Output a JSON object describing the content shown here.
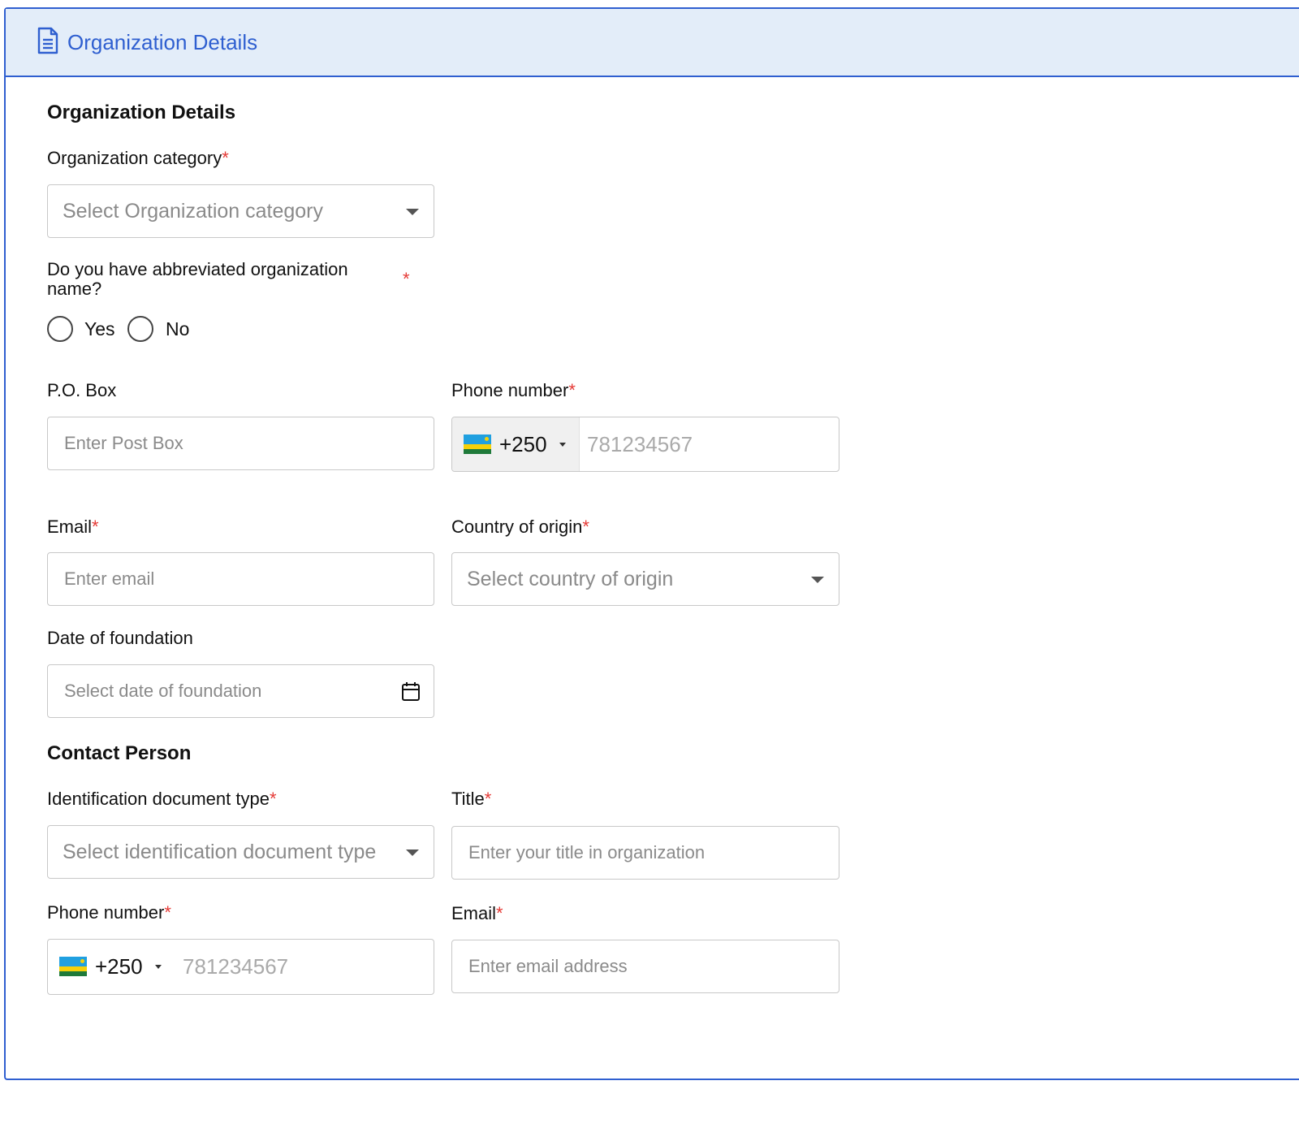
{
  "header": {
    "title": "Organization Details",
    "icon": "document-icon"
  },
  "org_section": {
    "title": "Organization Details"
  },
  "org_category": {
    "label": "Organization category",
    "required": "*",
    "placeholder": "Select Organization category"
  },
  "abbreviated": {
    "label_line1": "Do you have abbreviated organization",
    "label_line2": "name?",
    "required": "*",
    "yes": "Yes",
    "no": "No"
  },
  "po_box": {
    "label": "P.O. Box",
    "placeholder": "Enter Post Box"
  },
  "org_phone": {
    "label": "Phone number",
    "required": "*",
    "dial_code": "+250",
    "placeholder": "781234567"
  },
  "org_email": {
    "label": "Email",
    "required": "*",
    "placeholder": "Enter email"
  },
  "country": {
    "label": "Country of origin",
    "required": "*",
    "placeholder": "Select country of origin"
  },
  "foundation": {
    "label": "Date of foundation",
    "placeholder": "Select date of foundation"
  },
  "contact_section": {
    "title": "Contact Person"
  },
  "id_doc": {
    "label": "Identification document type",
    "required": "*",
    "placeholder": "Select identification document type"
  },
  "title_field": {
    "label": "Title",
    "required": "*",
    "placeholder": "Enter your title in organization"
  },
  "contact_phone": {
    "label": "Phone number",
    "required": "*",
    "dial_code": "+250",
    "placeholder": "781234567"
  },
  "contact_email": {
    "label": "Email",
    "required": "*",
    "placeholder": "Enter email address"
  },
  "colors": {
    "accent": "#2f5fd0",
    "header_bg": "#e3edf9",
    "required": "#e53935"
  }
}
